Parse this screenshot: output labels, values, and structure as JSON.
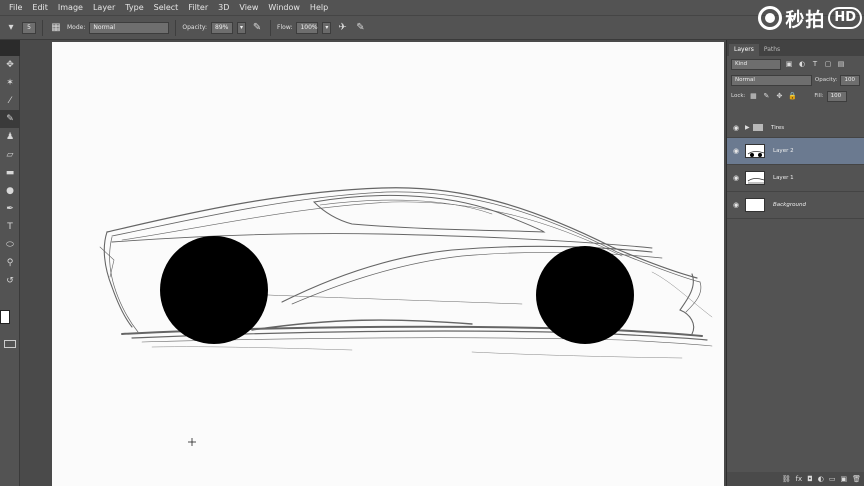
{
  "menu": [
    "File",
    "Edit",
    "Image",
    "Layer",
    "Type",
    "Select",
    "Filter",
    "3D",
    "View",
    "Window",
    "Help"
  ],
  "options": {
    "brush_size": "5",
    "mode_label": "Mode:",
    "mode_value": "Normal",
    "opacity_label": "Opacity:",
    "opacity_value": "89%",
    "flow_label": "Flow:",
    "flow_value": "100%"
  },
  "watermark": {
    "text": "秒拍",
    "badge": "HD"
  },
  "layers_panel": {
    "tabs": [
      "Layers",
      "Paths"
    ],
    "filter_kind": "Kind",
    "blend_mode": "Normal",
    "opacity_label": "Opacity:",
    "opacity_value": "100",
    "lock_label": "Lock:",
    "fill_label": "Fill:",
    "fill_value": "100",
    "layers": [
      {
        "name": "Tires",
        "type": "group",
        "selected": false
      },
      {
        "name": "Layer 2",
        "type": "layer",
        "selected": true
      },
      {
        "name": "Layer 1",
        "type": "layer",
        "selected": false
      },
      {
        "name": "Background",
        "type": "background",
        "selected": false
      }
    ]
  },
  "colors": {
    "ui_dark": "#535353",
    "canvas": "#fbfbfb",
    "selected_layer": "#6b7a90",
    "tire": "#000000"
  },
  "icons": {
    "tools": [
      "move-icon",
      "magic-wand-icon",
      "eyedropper-icon",
      "brush-icon",
      "clone-stamp-icon",
      "eraser-icon",
      "gradient-icon",
      "dodge-icon",
      "pen-icon",
      "type-icon",
      "ellipse-icon",
      "zoom-icon",
      "swap-colors-icon"
    ]
  }
}
